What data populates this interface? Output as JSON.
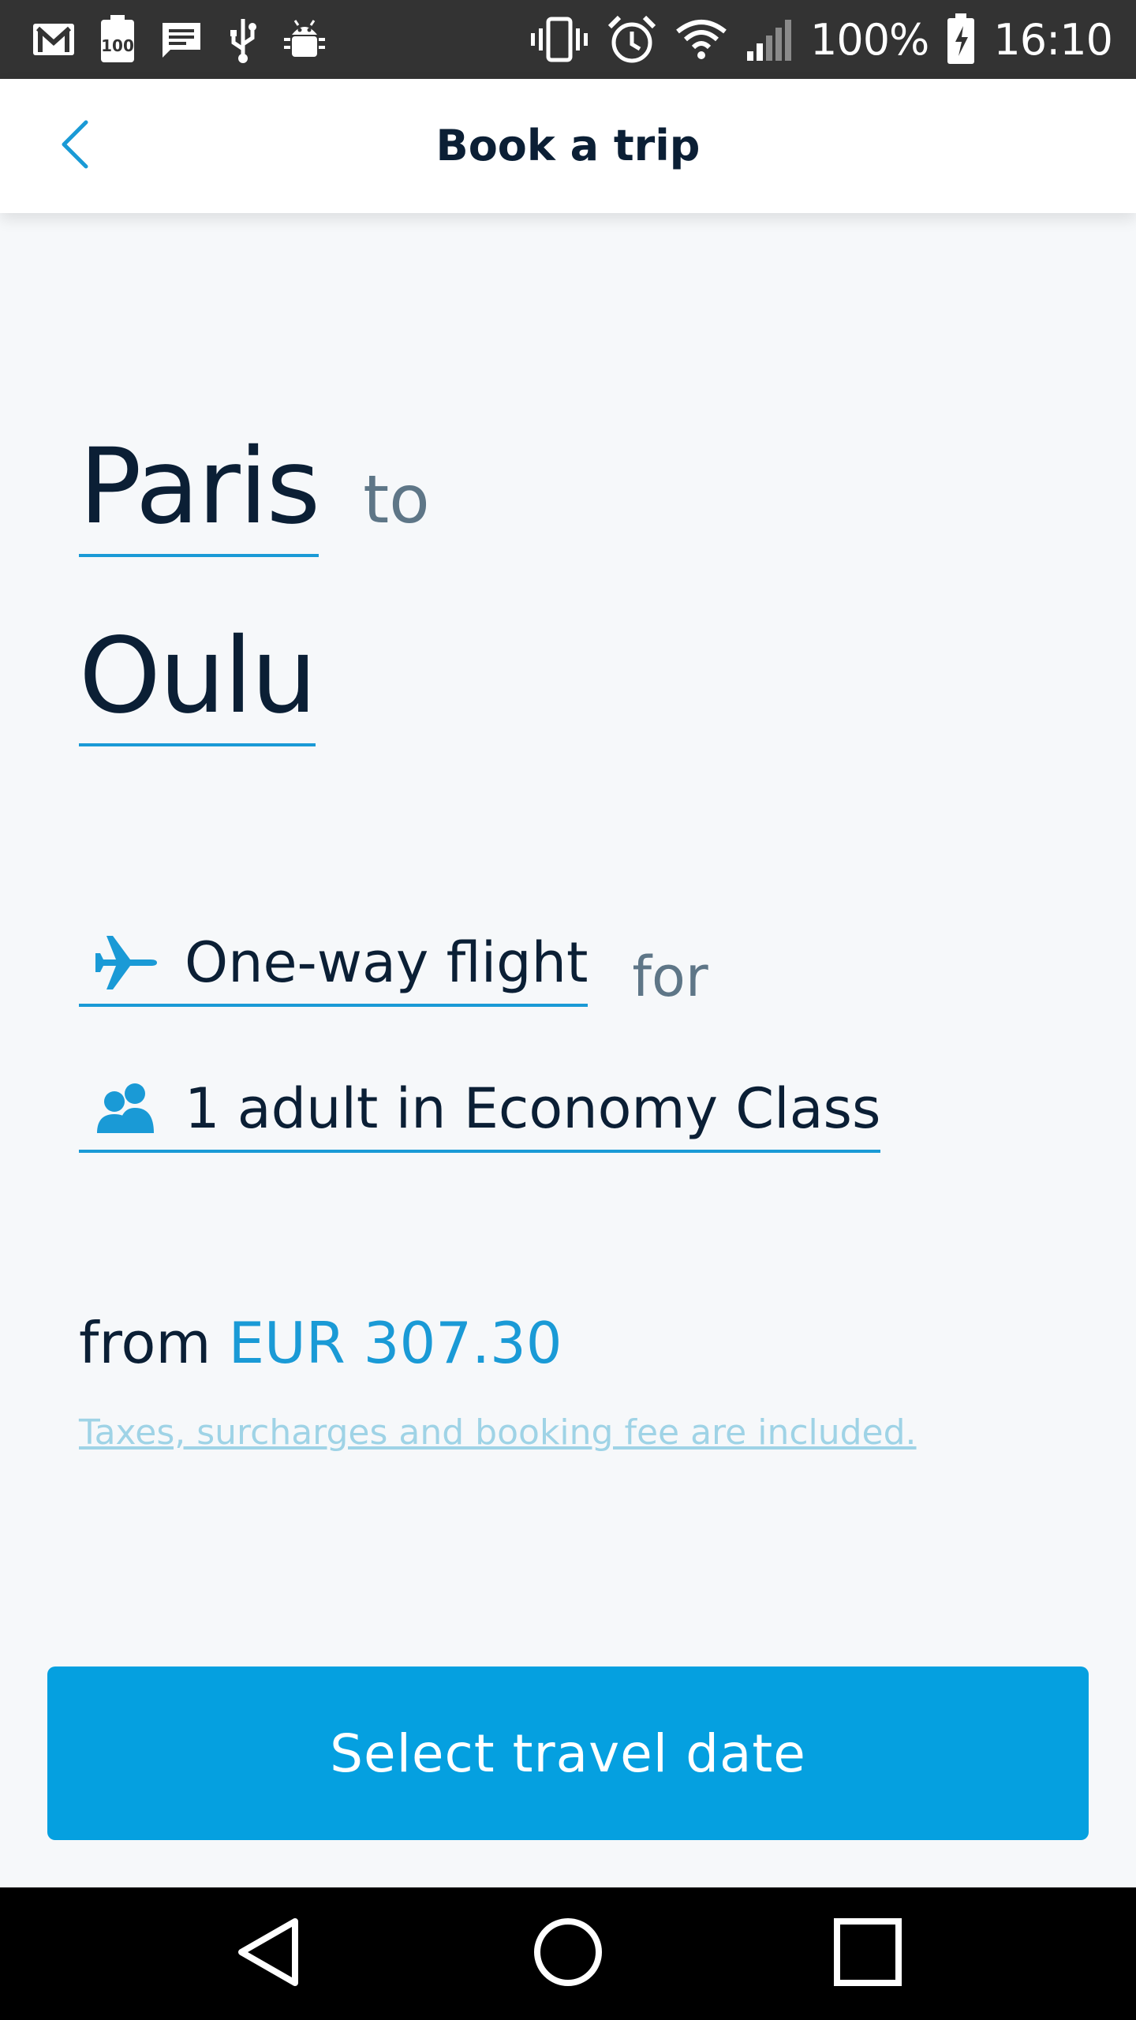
{
  "status_bar": {
    "battery": "100%",
    "time": "16:10",
    "left_icons": [
      "gmail-icon",
      "battery-saver-100-icon",
      "message-icon",
      "usb-icon",
      "android-debug-icon"
    ],
    "right_icons": [
      "vibrate-icon",
      "alarm-icon",
      "wifi-icon",
      "signal-icon",
      "battery-charging-icon"
    ]
  },
  "header": {
    "title": "Book a trip",
    "back_icon": "chevron-left-icon"
  },
  "route": {
    "origin": "Paris",
    "connector": "to",
    "destination": "Oulu"
  },
  "trip": {
    "type_icon": "airplane-icon",
    "type_label": "One-way flight",
    "connector": "for",
    "passengers_icon": "people-icon",
    "passengers_label": "1 adult in Economy Class"
  },
  "price": {
    "prefix": "from",
    "value": "EUR 307.30",
    "disclaimer": "Taxes, surcharges and booking fee are included."
  },
  "cta": {
    "label": "Select travel date"
  },
  "nav_bar": {
    "icons": [
      "back-triangle-icon",
      "home-circle-icon",
      "recents-square-icon"
    ]
  },
  "colors": {
    "accent": "#05a0e0",
    "underline": "#1a9ad6",
    "text_dark": "#0b1f35",
    "text_muted": "#5e7687",
    "disclaimer": "#9fd3e6",
    "background": "#f6f8fa",
    "status_bar": "#333333"
  }
}
